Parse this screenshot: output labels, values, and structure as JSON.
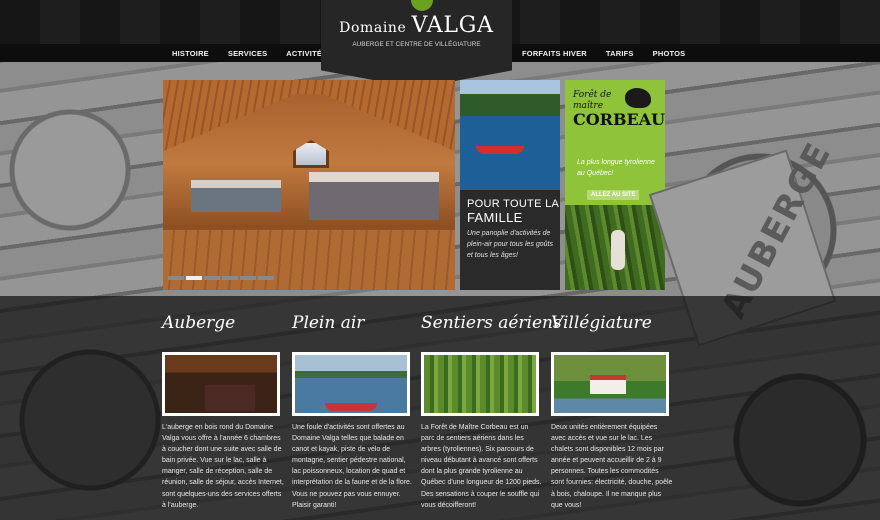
{
  "colors": {
    "accent_green": "#8ec33a",
    "nav_bg": "#0d0d0d",
    "logo_bg": "#262626"
  },
  "logo": {
    "small": "Domaine",
    "big": "VALGA",
    "subtitle": "AUBERGE ET CENTRE DE VILLÉGIATURE"
  },
  "nav_left": [
    "HISTOIRE",
    "SERVICES",
    "ACTIVITÉS"
  ],
  "nav_right": [
    "FORFAITS HIVER",
    "TARIFS",
    "PHOTOS"
  ],
  "slider": {
    "slide_count": 6,
    "active_index": 1
  },
  "promo_family": {
    "title_line1": "POUR TOUTE LA",
    "title_line2": "FAMILLE",
    "description": "Une panoplie d'activités de plein-air pour tous les goûts et tous les âges!"
  },
  "promo_corbeau": {
    "logo_line1": "Forêt de",
    "logo_line2": "maître",
    "logo_line3": "CORBEAU",
    "tagline": "La plus longue tyrolienne au Québec!",
    "button": "ALLEZ AU SITE"
  },
  "watermark": "AUBERGE",
  "columns": [
    {
      "title": "Auberge",
      "text": "L'auberge en bois rond du Domaine Valga vous offre à l'année 6 chambres à coucher dont une suite avec salle de bain privée. Vue sur le lac, salle à manger, salle de réception, salle de réunion, salle de séjour, accès Internet, sont quelques-uns des services offerts à l'auberge."
    },
    {
      "title": "Plein air",
      "text": "Une foule d'activités sont offertes au Domaine Valga telles que balade en canot et kayak, piste de vélo de montagne, sentier pédestre national, lac poissonneux, location de quad et interprétation de la faune et de la flore. Vous ne pouvez pas vous ennuyer. Plaisir garanti!"
    },
    {
      "title": "Sentiers aériens",
      "text": "La Forêt de Maître Corbeau est un parc de sentiers aériens dans les arbres (tyroliennes). Six parcours de niveau débutant à avancé sont offerts dont la plus grande tyrolienne au Québec d'une longueur de 1200 pieds. Des sensations à couper le souffle qui vous décoifferont!"
    },
    {
      "title": "Villégiature",
      "text": "Deux unités entièrement équipées avec accès et vue sur le lac. Les chalets sont disponibles 12 mois par année et peuvent accueillir de 2 à 9 personnes. Toutes les commodités sont fournies: électricité, douche, poêle à bois, chaloupe. Il ne manque plus que vous!"
    }
  ]
}
